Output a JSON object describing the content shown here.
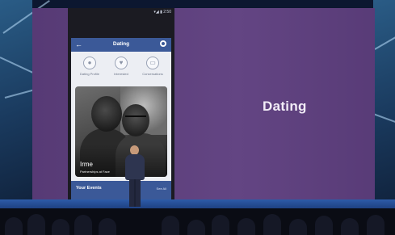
{
  "screen": {
    "heading": "Dating",
    "background_color": "#5e3f7f"
  },
  "phone": {
    "app_title": "Dating",
    "status_text": "▾◢ ▮ 2:50",
    "tabs": [
      {
        "label": "Dating Profile",
        "icon": "person-icon"
      },
      {
        "label": "Interested",
        "icon": "heart-icon"
      },
      {
        "label": "Conversations",
        "icon": "chat-icon"
      }
    ],
    "profile": {
      "name": "Irme",
      "detail": "Partnerships at Face"
    },
    "events": {
      "label": "Your Events",
      "see_all": "See All"
    },
    "accent_color": "#3b5998"
  }
}
